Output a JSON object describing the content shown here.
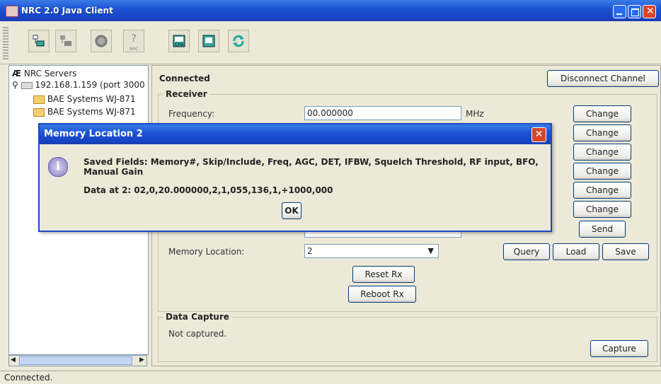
{
  "window": {
    "title": "NRC 2.0 Java Client"
  },
  "toolbar": {
    "buttons": [
      "connect-icon",
      "disconnect-icon",
      "record-icon",
      "help-icon",
      "config-icon",
      "channel-icon",
      "refresh-icon"
    ],
    "cfg_label": "CFG",
    "nrc_label": "NRC"
  },
  "tree": {
    "root": "NRC Servers",
    "server": "192.168.1.159 (port 3000",
    "items": [
      "BAE Systems WJ-871",
      "BAE Systems WJ-871"
    ]
  },
  "status_bar": "Connected.",
  "main": {
    "connection_status": "Connected",
    "disconnect_label": "Disconnect Channel",
    "receiver_legend": "Receiver",
    "frequency_label": "Frequency:",
    "frequency_value": "00.000000",
    "frequency_unit": "MHz",
    "change_label": "Change",
    "send_label": "Send",
    "memory_location_label": "Memory Location:",
    "memory_location_value": "2",
    "query_label": "Query",
    "load_label": "Load",
    "save_label": "Save",
    "reset_label": "Reset Rx",
    "reboot_label": "Reboot Rx",
    "data_capture_legend": "Data Capture",
    "capture_status": "Not captured.",
    "capture_label": "Capture"
  },
  "dialog": {
    "title": "Memory Location 2",
    "saved_fields": "Saved Fields: Memory#, Skip/Include, Freq, AGC, DET, IFBW, Squelch Threshold, RF input, BFO, Manual Gain",
    "data": "Data at 2: 02,0,20.000000,2,1,055,136,1,+1000,000",
    "ok_label": "OK"
  },
  "colors": {
    "titlebar": "#1d55d6",
    "close": "#d5482a",
    "panel_bg": "#ece9d8"
  }
}
